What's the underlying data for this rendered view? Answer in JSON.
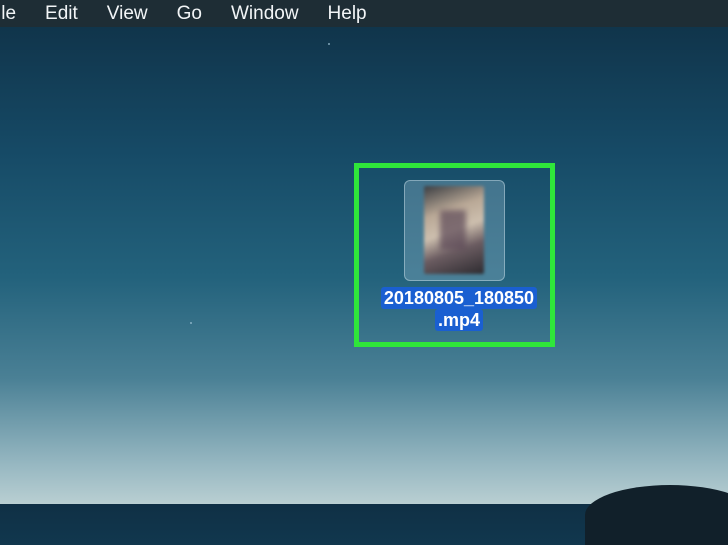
{
  "menubar": {
    "items": [
      {
        "label": "ile"
      },
      {
        "label": "Edit"
      },
      {
        "label": "View"
      },
      {
        "label": "Go"
      },
      {
        "label": "Window"
      },
      {
        "label": "Help"
      }
    ]
  },
  "desktop": {
    "file": {
      "name_line1": "20180805_180850",
      "name_line2": ".mp4",
      "icon": "video-thumbnail-icon",
      "highlight_color": "#2fe63a",
      "selection_color": "#1a5fd1"
    }
  }
}
